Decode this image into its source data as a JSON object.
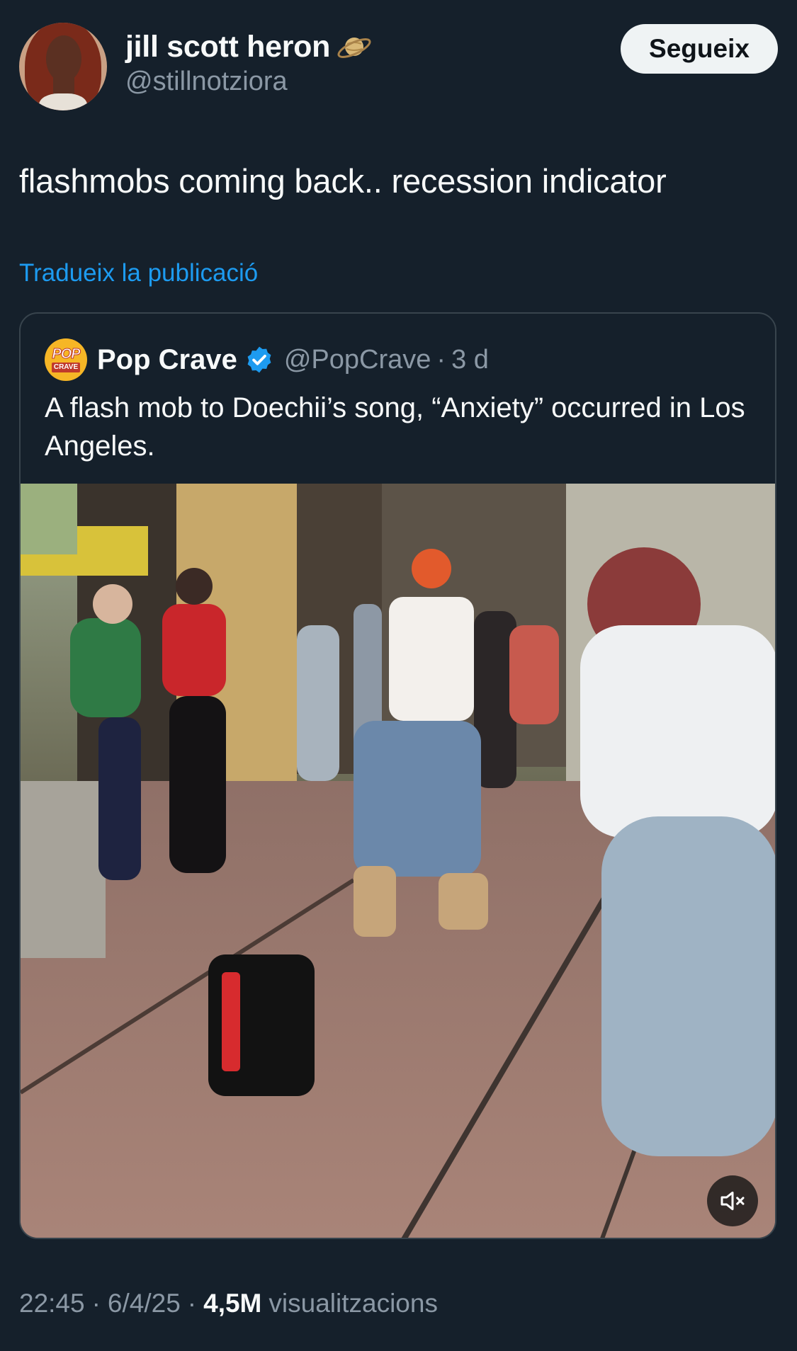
{
  "author": {
    "display_name": "jill scott heron",
    "handle": "@stillnotziora",
    "badge_icon": "ringed-planet-icon"
  },
  "follow_button_label": "Segueix",
  "tweet_text": "flashmobs coming back.. recession indicator",
  "translate_label": "Tradueix la publicació",
  "quoted": {
    "avatar_label_top": "POP",
    "avatar_label_bottom": "CRAVE",
    "display_name": "Pop Crave",
    "verified": true,
    "handle": "@PopCrave",
    "separator": "·",
    "time": "3 d",
    "text": "A flash mob to Doechii’s song, “Anxiety” occurred in Los Angeles.",
    "media": {
      "type": "video",
      "description_icon": "video-flash-mob",
      "muted": true,
      "mute_icon": "speaker-muted-icon"
    }
  },
  "meta": {
    "time": "22:45",
    "separator": "·",
    "date": "6/4/25",
    "views_count": "4,5M",
    "views_label": "visualitzacions"
  },
  "colors": {
    "background": "#15202b",
    "primary_text": "#f7f9f9",
    "secondary_text": "#8b98a5",
    "link": "#1d9bf0",
    "border": "#38444d",
    "verified": "#1d9bf0"
  }
}
